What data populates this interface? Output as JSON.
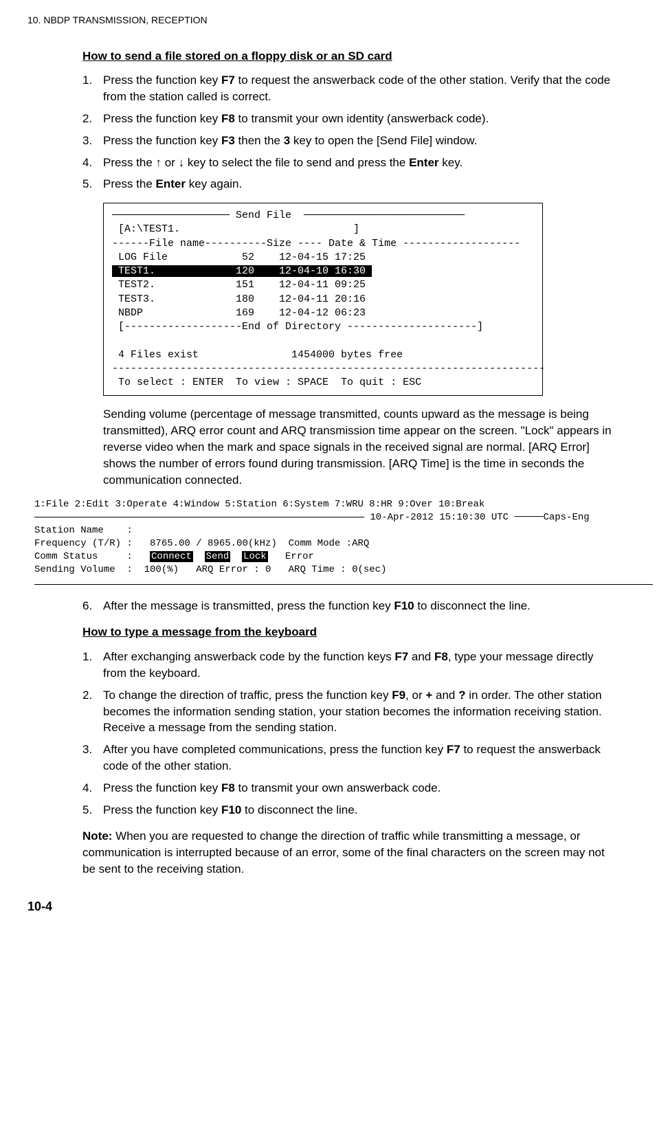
{
  "header": "10.  NBDP TRANSMISSION, RECEPTION",
  "section1": {
    "title": "How to send a file stored on a floppy disk or an SD card",
    "steps": [
      "Press the function key <b>F7</b> to request the answerback code of the other station. Verify that the code from the station called is correct.",
      "Press the function key <b>F8</b> to transmit your own identity (answerback code).",
      "Press the function key <b>F3</b> then the <b>3</b> key to open the [Send File] window.",
      "Press the ↑ or ↓ key to select the file to send and press the <b>Enter</b> key.",
      "Press the <b>Enter</b> key again."
    ]
  },
  "figure1": {
    "title_left": "─────────────────── Send File  ──────────────────────────",
    "path": " [A:\\TEST1.                            ]",
    "header_line": "------File name----------Size ---- Date & Time -------------------",
    "rows": [
      {
        "name": "LOG File",
        "size": "52",
        "datetime": "12-04-15 17:25",
        "highlight": false
      },
      {
        "name": "TEST1.",
        "size": "120",
        "datetime": "12-04-10 16:30",
        "highlight": true
      },
      {
        "name": "TEST2.",
        "size": "151",
        "datetime": "12-04-11 09:25",
        "highlight": false
      },
      {
        "name": "TEST3.",
        "size": "180",
        "datetime": "12-04-11 20:16",
        "highlight": false
      },
      {
        "name": "NBDP",
        "size": "169",
        "datetime": "12-04-12 06:23",
        "highlight": false
      }
    ],
    "end_line": " [-------------------End of Directory ---------------------]",
    "status": " 4 Files exist               1454000 bytes free",
    "dashes": "----------------------------------------------------------------------",
    "help": " To select : ENTER  To view : SPACE  To quit : ESC"
  },
  "para1": "Sending volume (percentage of message transmitted, counts upward as the message is being transmitted), ARQ error count and ARQ transmission time appear on the screen. \"Lock\" appears in reverse video when the mark and space signals in the received signal are normal. [ARQ Error] shows the number of errors found during transmission. [ARQ Time] is the time in seconds the communication connected.",
  "figure2": {
    "menu": "1:File 2:Edit 3:Operate 4:Window 5:Station 6:System 7:WRU 8:HR 9:Over 10:Break",
    "datetime": "10-Apr-2012 15:10:30 UTC ─────Caps-Eng",
    "station": "Station Name    :",
    "freq": "Frequency (T/R) :   8765.00 / 8965.00(kHz)  Comm Mode :ARQ",
    "comm_prefix": "Comm Status     :   ",
    "comm_badges": [
      "Connect",
      "Send",
      "Lock"
    ],
    "comm_suffix": " Error",
    "volume": "Sending Volume  :  100(%)   ARQ Error : 0   ARQ Time : 0(sec)"
  },
  "step6": "After the message is transmitted, press the function key <b>F10</b> to disconnect the line.",
  "section2": {
    "title": "How to type a message from the keyboard",
    "steps": [
      "After exchanging answerback code by the function keys <b>F7</b> and <b>F8</b>, type your message directly from the keyboard.",
      "To change the direction of traffic, press the function key <b>F9</b>, or <b>+</b> and <b>?</b> in order. The other station becomes the information sending station, your station becomes the information receiving station. Receive a message from the sending station.",
      "After you have completed communications, press the function key <b>F7</b> to request the answerback code of the other station.",
      "Press the function key <b>F8</b> to transmit your own answerback code.",
      "Press the function key <b>F10</b> to disconnect the line."
    ]
  },
  "note": "<b>Note:</b> When you are requested to change the direction of traffic while transmitting a message, or communication is interrupted because of an error, some of the final characters on the screen may not be sent to the receiving station.",
  "page_num": "10-4"
}
